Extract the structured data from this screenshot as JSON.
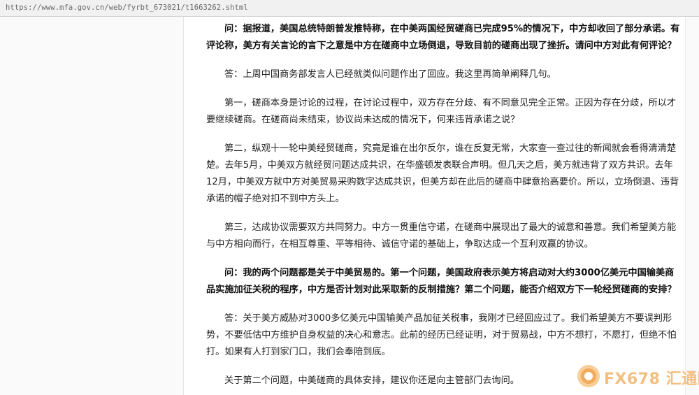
{
  "browser": {
    "url": "https://www.mfa.gov.cn/web/fyrbt_673021/t1663262.shtml"
  },
  "article": {
    "paragraphs": [
      {
        "type": "question",
        "text": "问：据报道，美国总统特朗普发推特称，在中美两国经贸磋商已完成95%的情况下，中方却收回了部分承诺。有评论称，美方有关言论的言下之意是中方在磋商中立场倒退，导致目前的磋商出现了挫折。请问中方对此有何评论？"
      },
      {
        "type": "answer",
        "text": "答：上周中国商务部发言人已经就类似问题作出了回应。我这里再简单阐释几句。"
      },
      {
        "type": "answer",
        "text": "第一，磋商本身是讨论的过程，在讨论过程中，双方存在分歧、有不同意见完全正常。正因为存在分歧，所以才要继续磋商。在磋商尚未结束，协议尚未达成的情况下，何来违背承诺之说？"
      },
      {
        "type": "answer",
        "text": "第二，纵观十一轮中美经贸磋商，究竟是谁在出尔反尔，谁在反复无常，大家查一查过往的新闻就会看得清清楚楚。去年5月，中美双方就经贸问题达成共识，在华盛顿发表联合声明。但几天之后，美方就违背了双方共识。去年12月，中美双方就中方对美贸易采购数字达成共识，但美方却在此后的磋商中肆意抬高要价。所以，立场倒退、违背承诺的帽子绝对扣不到中方头上。"
      },
      {
        "type": "answer",
        "text": "第三，达成协议需要双方共同努力。中方一贯重信守诺，在磋商中展现出了最大的诚意和善意。我们希望美方能与中方相向而行，在相互尊重、平等相待、诚信守诺的基础上，争取达成一个互利双赢的协议。"
      },
      {
        "type": "question",
        "text": "问：我的两个问题都是关于中美贸易的。第一个问题，美国政府表示美方将启动对大约3000亿美元中国输美商品实施加征关税的程序，中方是否计划对此采取新的反制措施？第二个问题，能否介绍双方下一轮经贸磋商的安排？"
      },
      {
        "type": "answer",
        "text": "答：关于美方威胁对3000多亿美元中国输美产品加征关税事，我刚才已经回应过了。我们希望美方不要误判形势，不要低估中方维护自身权益的决心和意志。此前的经历已经证明，对于贸易战，中方不想打，不愿打，但绝不怕打。如果有人打到家门口，我们会奉陪到底。"
      },
      {
        "type": "answer",
        "text": "关于第二个问题，中美磋商的具体安排，建议你还是向主管部门去询问。"
      }
    ]
  },
  "watermark": {
    "text": "FX678 汇通网",
    "icon": "fx678-logo-icon",
    "color": "#f2b46a"
  }
}
